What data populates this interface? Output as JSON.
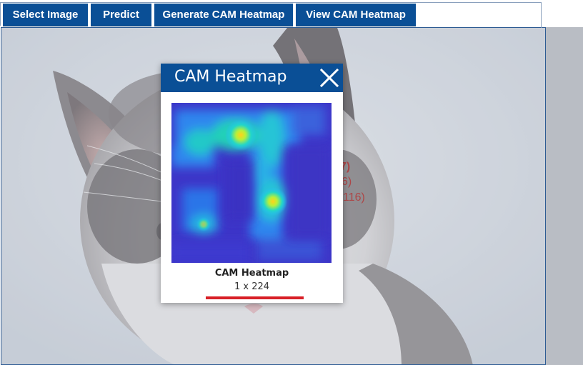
{
  "toolbar": {
    "buttons": [
      {
        "label": "Select Image"
      },
      {
        "label": "Predict"
      },
      {
        "label": "Generate CAM Heatmap"
      },
      {
        "label": "View CAM Heatmap"
      }
    ]
  },
  "background": {
    "prediction_fragments": [
      "7)",
      "6)",
      "116)"
    ]
  },
  "modal": {
    "title": "CAM Heatmap",
    "close_icon": "close-icon",
    "image_caption": "CAM Heatmap",
    "image_dims": "1 x 224"
  },
  "colors": {
    "accent": "#0a4f96",
    "underline": "#d82027",
    "heatmap_low": "#3d35c8",
    "heatmap_high": "#ffd21a"
  }
}
